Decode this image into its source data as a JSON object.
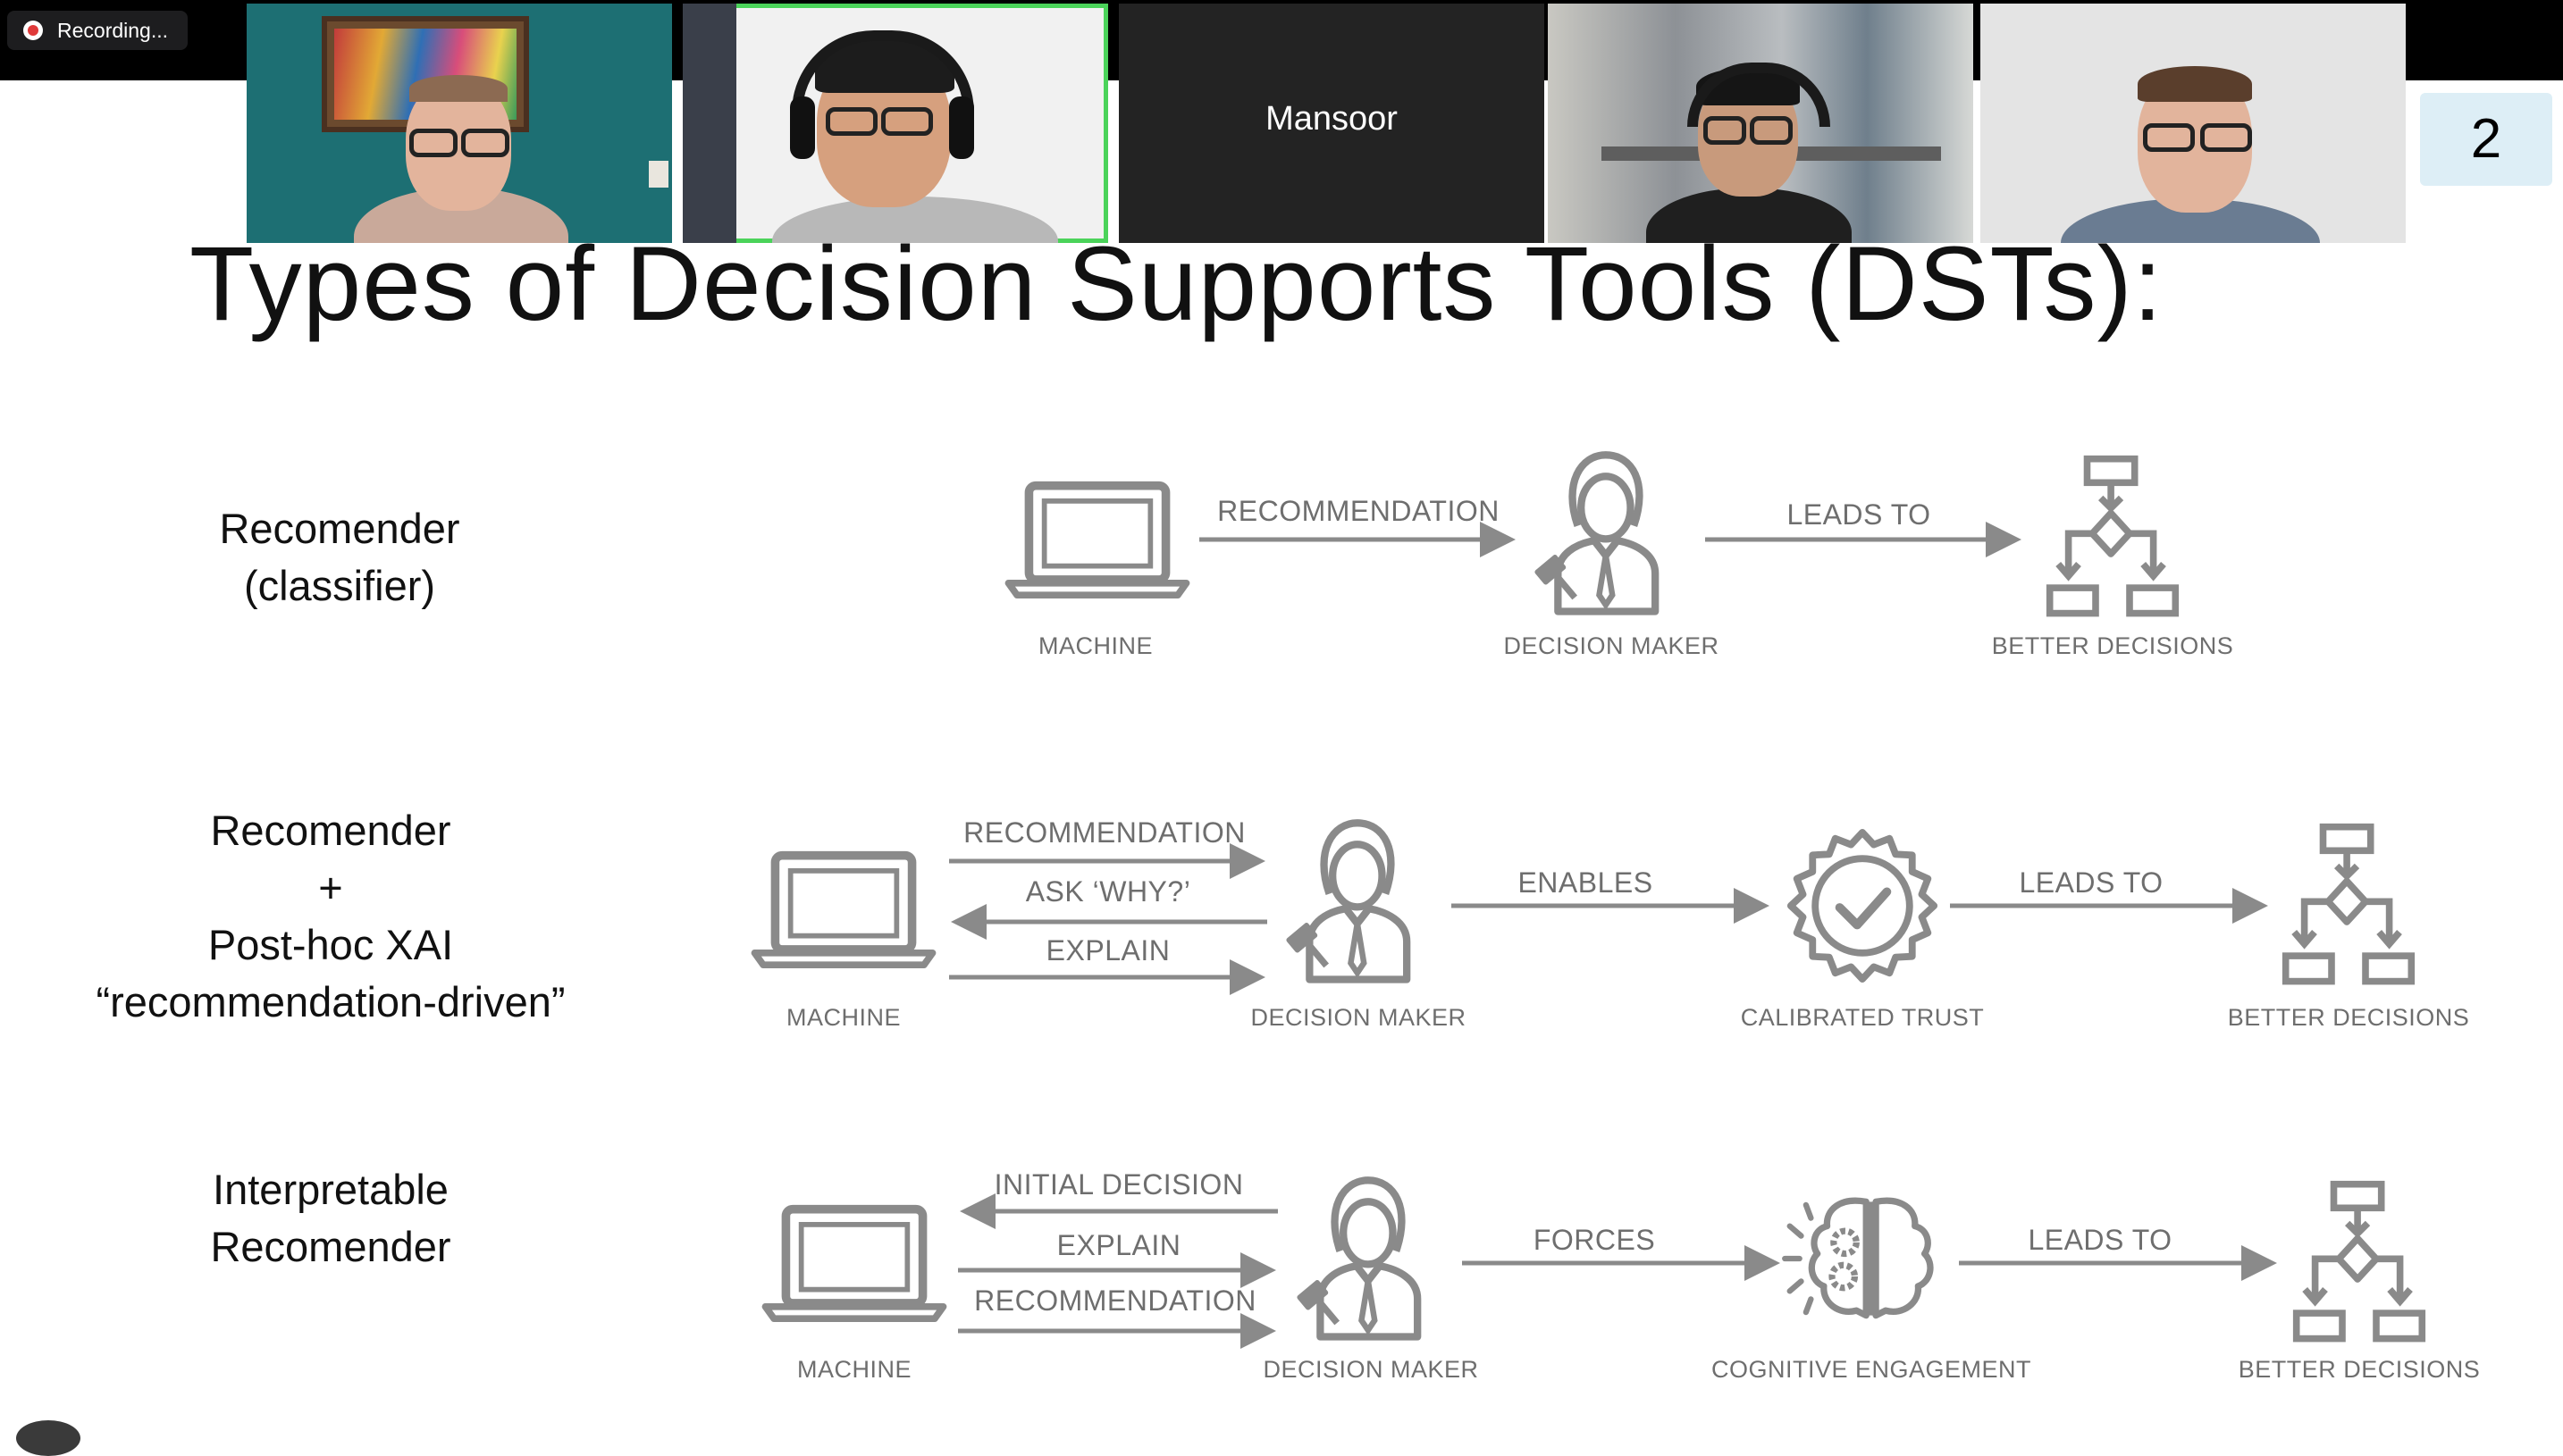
{
  "recording": {
    "label": "Recording..."
  },
  "participants": [
    {
      "name": "",
      "video": true
    },
    {
      "name": "",
      "video": true,
      "active_speaker": true
    },
    {
      "name": "Mansoor",
      "video": false
    },
    {
      "name": "",
      "video": true
    },
    {
      "name": "",
      "video": true
    }
  ],
  "slide": {
    "number": "2",
    "title": "Types of Decision Supports Tools (DSTs):",
    "rows": [
      {
        "label_lines": [
          "Recomender",
          "(classifier)"
        ],
        "captions": {
          "machine": "MACHINE",
          "decision_maker": "DECISION MAKER",
          "better": "BETTER DECISIONS"
        },
        "arrows": {
          "recommendation": "RECOMMENDATION",
          "leads_to": "LEADS TO"
        }
      },
      {
        "label_lines": [
          "Recomender",
          "+",
          "Post-hoc XAI",
          "“recommendation-driven”"
        ],
        "captions": {
          "machine": "MACHINE",
          "decision_maker": "DECISION MAKER",
          "middle": "CALIBRATED TRUST",
          "better": "BETTER DECISIONS"
        },
        "arrows": {
          "recommendation": "RECOMMENDATION",
          "ask_why": "ASK ‘WHY?’",
          "explain": "EXPLAIN",
          "enables": "ENABLES",
          "leads_to": "LEADS TO"
        }
      },
      {
        "label_lines": [
          "Interpretable",
          "Recomender"
        ],
        "captions": {
          "machine": "MACHINE",
          "decision_maker": "DECISION MAKER",
          "middle": "COGNITIVE ENGAGEMENT",
          "better": "BETTER DECISIONS"
        },
        "arrows": {
          "initial_decision": "INITIAL DECISION",
          "explain": "EXPLAIN",
          "recommendation": "RECOMMENDATION",
          "forces": "FORCES",
          "leads_to": "LEADS TO"
        }
      }
    ]
  },
  "colors": {
    "icon_gray": "#8a8a8a",
    "active_speaker_border": "#4bd35a",
    "slide_number_bg": "#ddeef6"
  },
  "icons": [
    "laptop-icon",
    "decision-maker-icon",
    "flowchart-icon",
    "checkmark-badge-icon",
    "brain-gears-icon",
    "record-icon"
  ]
}
